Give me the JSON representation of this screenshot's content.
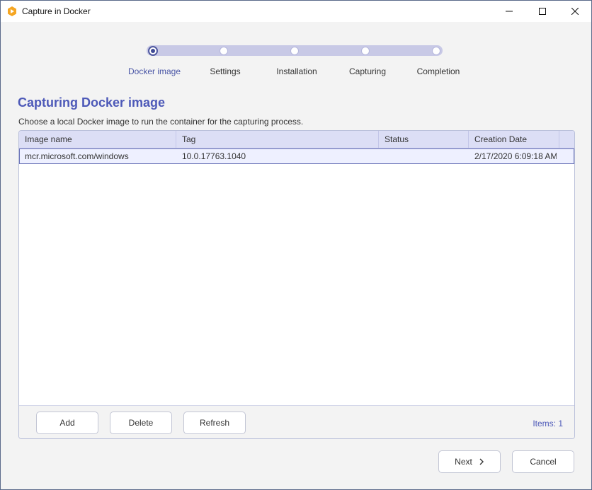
{
  "window": {
    "title": "Capture in Docker",
    "accent_color": "#4d59b8",
    "icon": "app-logo-icon"
  },
  "stepper": {
    "steps": [
      {
        "label": "Docker image",
        "active": true
      },
      {
        "label": "Settings",
        "active": false
      },
      {
        "label": "Installation",
        "active": false
      },
      {
        "label": "Capturing",
        "active": false
      },
      {
        "label": "Completion",
        "active": false
      }
    ]
  },
  "page": {
    "heading": "Capturing Docker image",
    "description": "Choose a local Docker image to run the container for the capturing process."
  },
  "table": {
    "columns": [
      "Image name",
      "Tag",
      "Status",
      "Creation Date"
    ],
    "rows": [
      {
        "image_name": "mcr.microsoft.com/windows",
        "tag": "10.0.17763.1040",
        "status": "",
        "creation_date": "2/17/2020 6:09:18 AM"
      }
    ]
  },
  "table_footer": {
    "add_label": "Add",
    "delete_label": "Delete",
    "refresh_label": "Refresh",
    "items_count": "Items: 1"
  },
  "dialog_buttons": {
    "next_label": "Next",
    "cancel_label": "Cancel"
  }
}
